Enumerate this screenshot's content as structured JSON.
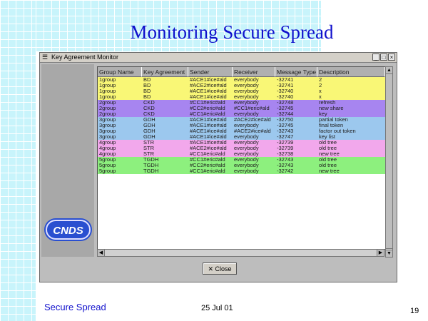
{
  "slide": {
    "title": "Monitoring Secure Spread",
    "footer_left": "Secure Spread",
    "footer_date": "25 Jul 01",
    "page_number": "19"
  },
  "window": {
    "title": "Key Agreement Monitor",
    "menu_glyph": "☰",
    "minimize_glyph": "_",
    "maximize_glyph": "□",
    "close_glyph": "×",
    "logo_text": "CNDS",
    "close_button_label": "✕ Close"
  },
  "table": {
    "columns": [
      "Group Name",
      "Key Agreement",
      "Sender",
      "Receiver",
      "Message Type",
      "Description"
    ],
    "rows": [
      {
        "cells": [
          "1group",
          "BD",
          "#ACE1#ice#ald",
          "everybody",
          "-32741",
          "2"
        ],
        "color": "#f9f776"
      },
      {
        "cells": [
          "1group",
          "BD",
          "#ACE2#ice#ald",
          "everybody",
          "-32741",
          "2"
        ],
        "color": "#f9f776"
      },
      {
        "cells": [
          "1group",
          "BD",
          "#ACE1#ice#ald",
          "everybody",
          "-32740",
          "x"
        ],
        "color": "#f9f776"
      },
      {
        "cells": [
          "1group",
          "BD",
          "#ACE1#ice#ald",
          "everybody",
          "-32740",
          "x"
        ],
        "color": "#f9f776"
      },
      {
        "cells": [
          "2group",
          "CKD",
          "#CC1#eric#ald",
          "everybody",
          "-32748",
          "refresh"
        ],
        "color": "#a785f0"
      },
      {
        "cells": [
          "2group",
          "CKD",
          "#CC2#eric#ald",
          "#CC1#eric#ald",
          "-32745",
          "new share"
        ],
        "color": "#a785f0"
      },
      {
        "cells": [
          "2group",
          "CKD",
          "#CC1#eric#ald",
          "everybody",
          "-32744",
          "key"
        ],
        "color": "#a785f0"
      },
      {
        "cells": [
          "3group",
          "GDH",
          "#ACE1#ice#ald",
          "#ACE2#ice#ald",
          "-32750",
          "partial token"
        ],
        "color": "#9cc8ee"
      },
      {
        "cells": [
          "3group",
          "GDH",
          "#ACE1#ice#ald",
          "everybody",
          "-32745",
          "final token"
        ],
        "color": "#9cc8ee"
      },
      {
        "cells": [
          "3group",
          "GDH",
          "#ACE1#ice#ald",
          "#ACE2#ice#ald",
          "-32743",
          "factor out token"
        ],
        "color": "#9cc8ee"
      },
      {
        "cells": [
          "3group",
          "GDH",
          "#ACE1#ice#ald",
          "everybody",
          "-32747",
          "key list"
        ],
        "color": "#9cc8ee"
      },
      {
        "cells": [
          "4group",
          "STR",
          "#ACE1#ice#ald",
          "everybody",
          "-32739",
          "old tree"
        ],
        "color": "#f2a8ec"
      },
      {
        "cells": [
          "4group",
          "STR",
          "#ACE2#ice#ald",
          "everybody",
          "-32739",
          "old tree"
        ],
        "color": "#f2a8ec"
      },
      {
        "cells": [
          "4group",
          "STR",
          "#CC1#eric#ald",
          "everybody",
          "-32738",
          "new tree"
        ],
        "color": "#f2a8ec"
      },
      {
        "cells": [
          "5group",
          "TGDH",
          "#CC1#eric#ald",
          "everybody",
          "-32743",
          "old tree"
        ],
        "color": "#8df07e"
      },
      {
        "cells": [
          "5group",
          "TGDH",
          "#CC2#eric#ald",
          "everybody",
          "-32743",
          "old tree"
        ],
        "color": "#8df07e"
      },
      {
        "cells": [
          "5group",
          "TGDH",
          "#CC1#eric#ald",
          "everybody",
          "-32742",
          "new tree"
        ],
        "color": "#8df07e"
      }
    ]
  }
}
